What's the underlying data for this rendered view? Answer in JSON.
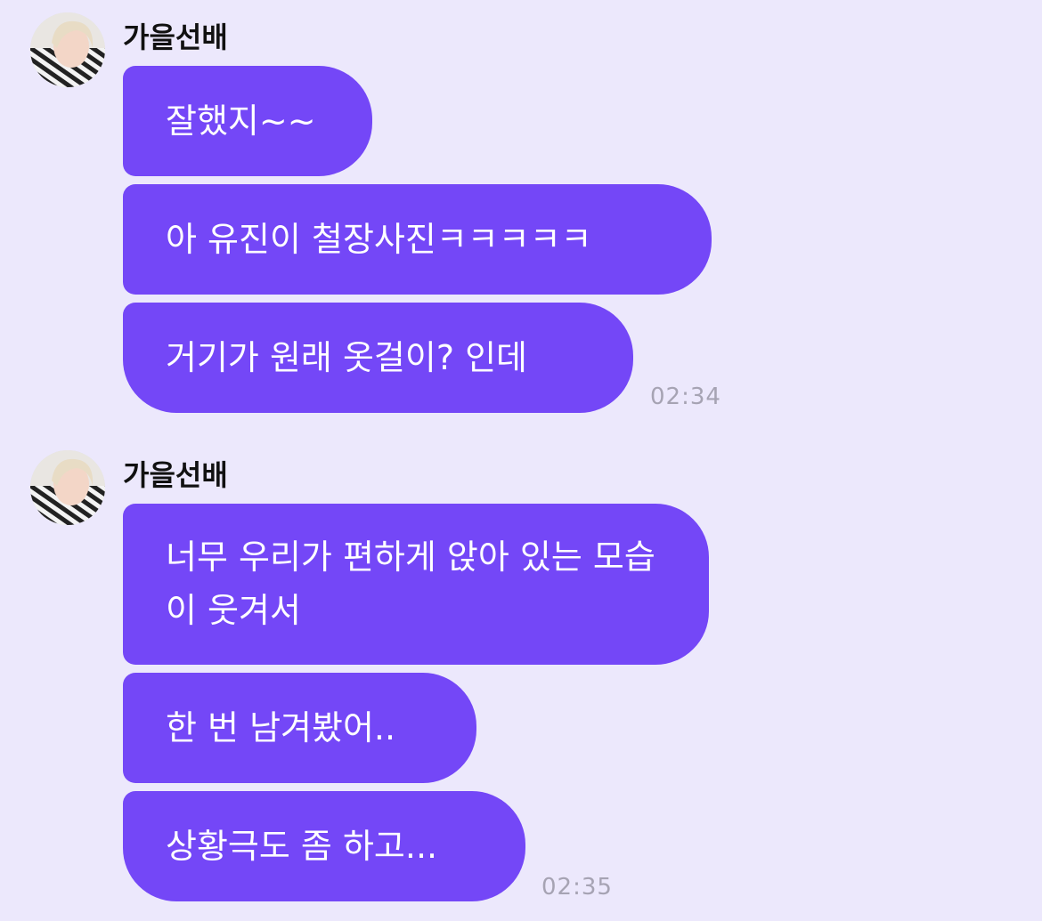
{
  "groups": [
    {
      "sender": "가을선배",
      "messages": [
        "잘했지~~",
        "아 유진이 철장사진ㅋㅋㅋㅋㅋ",
        "거기가 원래 옷걸이? 인데"
      ],
      "time": "02:34"
    },
    {
      "sender": "가을선배",
      "messages": [
        "너무 우리가 편하게 앉아 있는 모습이 웃겨서",
        "한 번 남겨봤어..",
        "상황극도 좀 하고..."
      ],
      "time": "02:35"
    }
  ],
  "colors": {
    "background": "#ece8fc",
    "bubble": "#7447f7",
    "bubble_text": "#ffffff",
    "time": "#a6a3b3"
  },
  "avatar_icon": "profile-photo"
}
